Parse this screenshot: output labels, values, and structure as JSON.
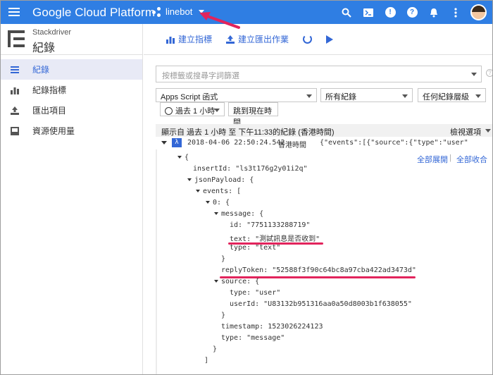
{
  "app": {
    "brand": "Google Cloud Platform",
    "project": "linebot"
  },
  "sidebar": {
    "product": "Stackdriver",
    "title": "紀錄",
    "items": [
      {
        "label": "紀錄",
        "icon": "list-icon"
      },
      {
        "label": "紀錄指標",
        "icon": "bar-chart-icon"
      },
      {
        "label": "匯出項目",
        "icon": "export-icon"
      },
      {
        "label": "資源使用量",
        "icon": "storage-icon"
      }
    ]
  },
  "toolbar": {
    "create_metric": "建立指標",
    "create_export": "建立匯出作業"
  },
  "filter": {
    "placeholder": "按標籤或搜尋字詞篩選",
    "resource": "Apps Script 函式",
    "logs": "所有紀錄",
    "level": "任何紀錄層級",
    "time_range": "過去 1 小時",
    "jump_now": "跳到現在時間"
  },
  "summary": {
    "text": "顯示自 過去 1 小時 至 下午11:33的紀錄 (香港時間)",
    "view_options": "檢視選項"
  },
  "entry": {
    "timestamp": "2018-04-06 22:50:24.542",
    "timezone": "香港時間",
    "preview": "{\"events\":[{\"source\":{\"type\":\"user\"",
    "expand_all": "全部展開",
    "separator": "|",
    "collapse_all": "全部收合"
  },
  "lines": [
    "{",
    "insertId: \"ls3t176g2y01i2q\"",
    "jsonPayload: {",
    "events: [",
    "0: {",
    "message: {",
    "id: \"7751133288719\"",
    "text: \"測試訊息是否收到\"",
    "type: \"text\"",
    "}",
    "replyToken: \"52588f3f90c64bc8a97cba422ad3473d\"",
    "source: {",
    "type: \"user\"",
    "userId: \"U83132b951316aa0a50d8003b1f638055\"",
    "}",
    "timestamp: 1523026224123",
    "type: \"message\"",
    "}",
    "]"
  ],
  "colors": {
    "topbar": "#2f7ee3",
    "accent": "#3367d6",
    "highlight": "#e2245c"
  }
}
